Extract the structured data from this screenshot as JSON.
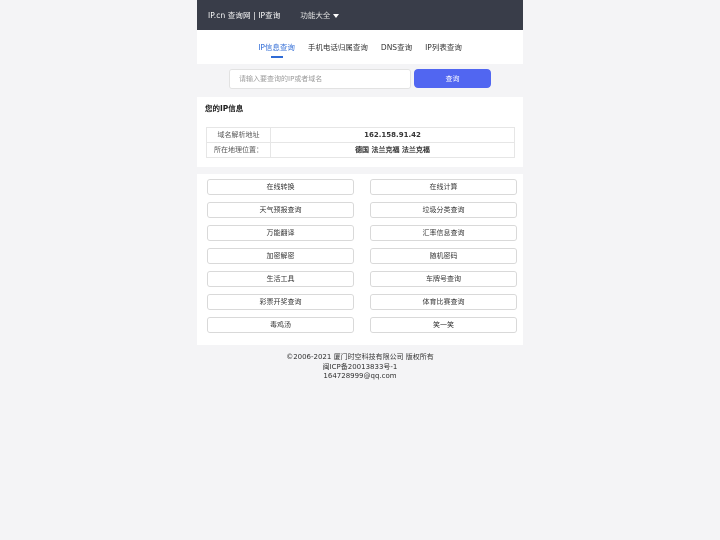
{
  "header": {
    "brand": "IP.cn 查询网 | IP查询",
    "menu_label": "功能大全"
  },
  "tabs": [
    {
      "label": "IP信息查询",
      "active": true
    },
    {
      "label": "手机电话归属查询",
      "active": false
    },
    {
      "label": "DNS查询",
      "active": false
    },
    {
      "label": "IP列表查询",
      "active": false
    }
  ],
  "search": {
    "placeholder": "请输入要查询的IP或者域名",
    "button_label": "查询"
  },
  "ip_info": {
    "title": "您的IP信息",
    "rows": [
      {
        "key": "域名解析地址",
        "value": "162.158.91.42"
      },
      {
        "key": "所在地理位置：",
        "value": "德国 法兰克福 法兰克福"
      }
    ]
  },
  "tools": [
    "在线转换",
    "在线计算",
    "天气预报查询",
    "垃圾分类查询",
    "万能翻译",
    "汇率信息查询",
    "加密解密",
    "随机密码",
    "生活工具",
    "车牌号查询",
    "彩票开奖查询",
    "体育比赛查询",
    "毒鸡汤",
    "笑一笑"
  ],
  "footer": {
    "copyright": "©2006-2021 厦门时空科技有限公司 版权所有",
    "icp": "闽ICP备20013833号-1",
    "email": "164728999@qq.com"
  }
}
